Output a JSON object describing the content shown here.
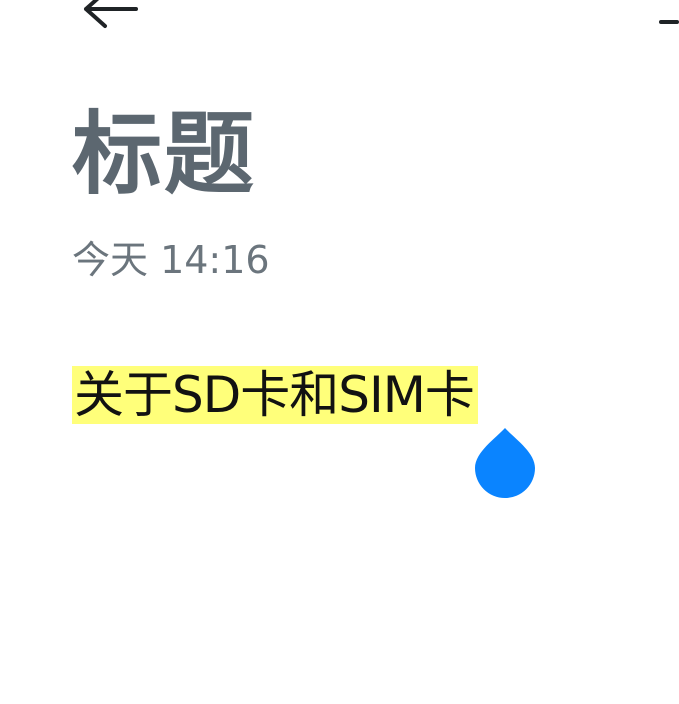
{
  "toolbar": {
    "back_icon": "arrow-left-icon",
    "menu_icon": "minus-icon"
  },
  "note": {
    "title": "标题",
    "timestamp": "今天 14:16",
    "selected_text": "关于SD卡和SIM卡"
  },
  "colors": {
    "title": "#5c6770",
    "timestamp": "#6b757d",
    "selection_highlight": "#ffff7a",
    "selection_handle": "#0a84ff"
  }
}
